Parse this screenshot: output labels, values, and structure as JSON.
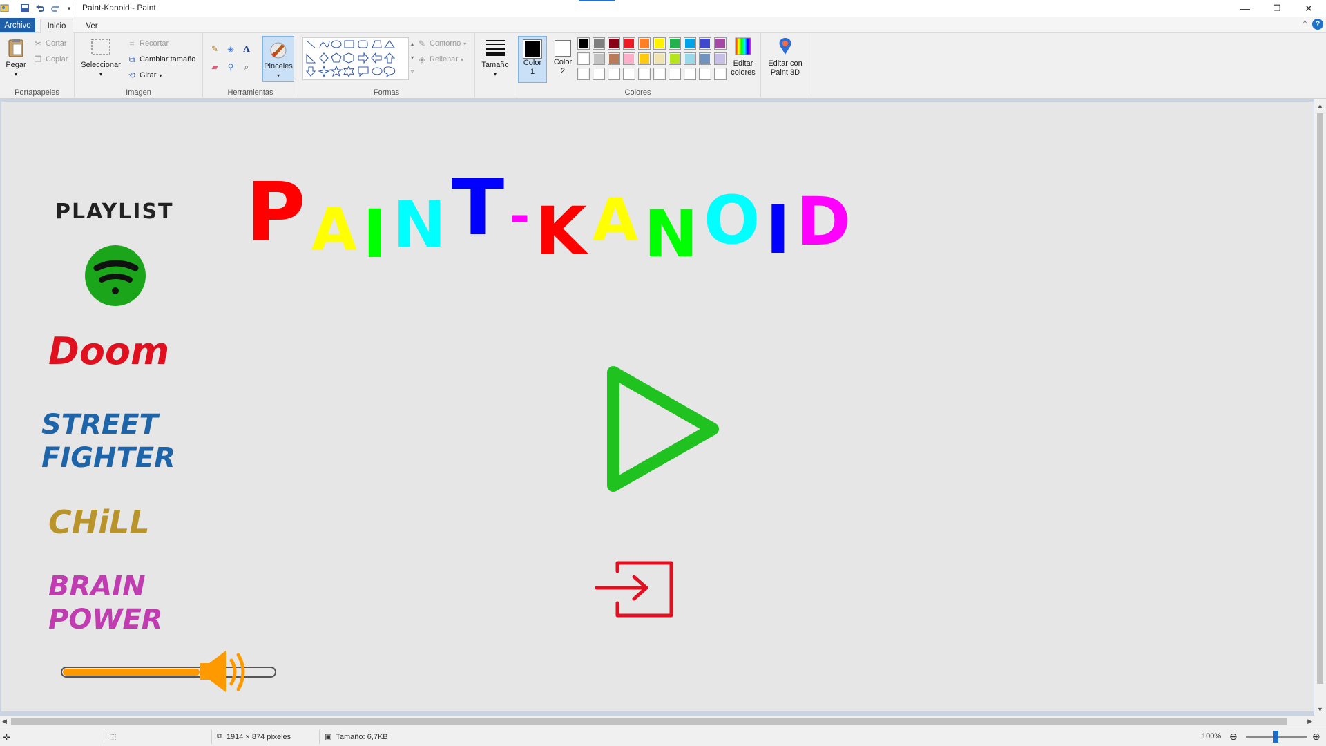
{
  "titlebar": {
    "title": "Paint-Kanoid - Paint",
    "quick_access": [
      "paint-app-icon",
      "save-icon",
      "undo-icon",
      "redo-icon",
      "customize-qat-icon"
    ]
  },
  "window_controls": {
    "minimize": "—",
    "restore": "❐",
    "close": "✕"
  },
  "menu": {
    "file": "Archivo",
    "home": "Inicio",
    "view": "Ver",
    "help": "?"
  },
  "ribbon": {
    "clipboard": {
      "label": "Portapapeles",
      "paste": "Pegar",
      "cut": "Cortar",
      "copy": "Copiar"
    },
    "image": {
      "label": "Imagen",
      "select": "Seleccionar",
      "crop": "Recortar",
      "resize": "Cambiar tamaño",
      "rotate": "Girar"
    },
    "tools": {
      "label": "Herramientas",
      "brushes": "Pinceles"
    },
    "shapes": {
      "label": "Formas",
      "outline": "Contorno",
      "fill": "Rellenar"
    },
    "size": {
      "label": "Tamaño"
    },
    "colors": {
      "label": "Colores",
      "color1": "Color\n1",
      "color2": "Color\n2",
      "edit_colors": "Editar colores",
      "edit_paint3d": "Editar con Paint 3D",
      "color1_value": "#000000",
      "color2_value": "#ffffff",
      "palette_row1": [
        "#000000",
        "#7f7f7f",
        "#880015",
        "#ed1c24",
        "#ff7f27",
        "#fff200",
        "#22b14c",
        "#00a2e8",
        "#3f48cc",
        "#a349a4"
      ],
      "palette_row2": [
        "#ffffff",
        "#c3c3c3",
        "#b97a57",
        "#ffaec9",
        "#ffc90e",
        "#efe4b0",
        "#b5e61d",
        "#99d9ea",
        "#7092be",
        "#c8bfe7"
      ],
      "palette_row3": [
        "#ffffff",
        "#ffffff",
        "#ffffff",
        "#ffffff",
        "#ffffff",
        "#ffffff",
        "#ffffff",
        "#ffffff",
        "#ffffff",
        "#ffffff"
      ]
    }
  },
  "canvas": {
    "title_letters": [
      {
        "ch": "P",
        "color": "#ff0000"
      },
      {
        "ch": "A",
        "color": "#ffff00"
      },
      {
        "ch": "I",
        "color": "#00ff00"
      },
      {
        "ch": "N",
        "color": "#00ffff"
      },
      {
        "ch": "T",
        "color": "#0000ff"
      },
      {
        "ch": "-",
        "color": "#ff00ff"
      },
      {
        "ch": "K",
        "color": "#ff0000"
      },
      {
        "ch": "A",
        "color": "#ffff00"
      },
      {
        "ch": "N",
        "color": "#00ff00"
      },
      {
        "ch": "O",
        "color": "#00ffff"
      },
      {
        "ch": "I",
        "color": "#0000ff"
      },
      {
        "ch": "D",
        "color": "#ff00ff"
      }
    ],
    "playlist_label": "PLAYLIST",
    "menu_items": [
      {
        "text": "Doom",
        "color": "#e0101f"
      },
      {
        "text": "STREET\nFIGHTER",
        "color": "#1e64a8"
      },
      {
        "text": "CHiLL",
        "color": "#b8942a"
      },
      {
        "text": "BRAIN\nPOWER",
        "color": "#c03cb0"
      }
    ],
    "volume_level": 0.66,
    "colors": {
      "spotify": "#1aa51a",
      "play": "#1fc21f",
      "exit": "#e01020",
      "volume": "#ff9900"
    }
  },
  "statusbar": {
    "dimensions": "1914 × 874 píxeles",
    "file_size": "Tamaño: 6,7KB",
    "zoom": "100%"
  }
}
